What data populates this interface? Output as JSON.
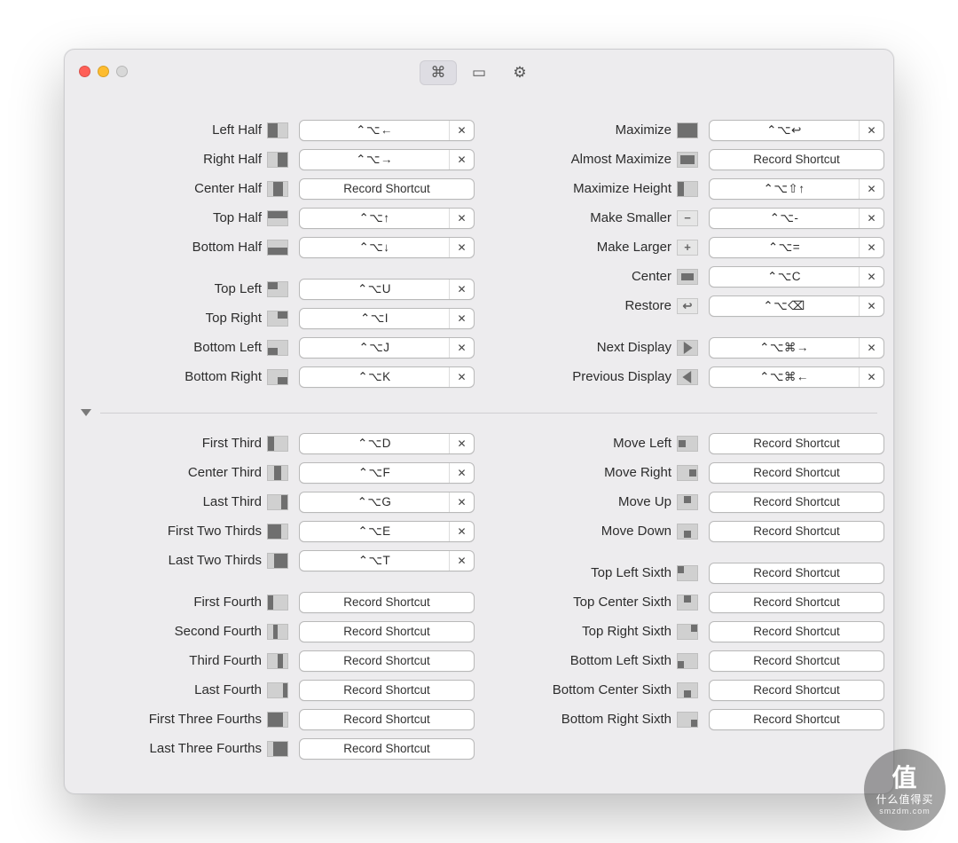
{
  "common": {
    "record_placeholder": "Record Shortcut",
    "clear_glyph": "✕"
  },
  "watermark": {
    "head": "值",
    "line1": "什么值得买",
    "line2": "smzdm.com"
  },
  "left": [
    {
      "group": [
        {
          "id": "left-half",
          "label": "Left Half",
          "shortcut": "⌃⌥←",
          "icon": "cols-1-2 p1"
        },
        {
          "id": "right-half",
          "label": "Right Half",
          "shortcut": "⌃⌥→",
          "icon": "cols-1-2 p2"
        },
        {
          "id": "center-half",
          "label": "Center Half",
          "shortcut": "",
          "icon": "center-h"
        },
        {
          "id": "top-half",
          "label": "Top Half",
          "shortcut": "⌃⌥↑",
          "icon": "rows-1-2 p1"
        },
        {
          "id": "bottom-half",
          "label": "Bottom Half",
          "shortcut": "⌃⌥↓",
          "icon": "rows-1-2 p2"
        }
      ]
    },
    {
      "group": [
        {
          "id": "top-left",
          "label": "Top Left",
          "shortcut": "⌃⌥U",
          "icon": "corners tl"
        },
        {
          "id": "top-right",
          "label": "Top Right",
          "shortcut": "⌃⌥I",
          "icon": "corners tr"
        },
        {
          "id": "bottom-left",
          "label": "Bottom Left",
          "shortcut": "⌃⌥J",
          "icon": "corners bl"
        },
        {
          "id": "bottom-right",
          "label": "Bottom Right",
          "shortcut": "⌃⌥K",
          "icon": "corners br"
        }
      ]
    }
  ],
  "right": [
    {
      "group": [
        {
          "id": "maximize",
          "label": "Maximize",
          "shortcut": "⌃⌥↩",
          "icon": "full"
        },
        {
          "id": "almost-maximize",
          "label": "Almost Maximize",
          "shortcut": "",
          "icon": "inset"
        },
        {
          "id": "maximize-height",
          "label": "Maximize Height",
          "shortcut": "⌃⌥⇧↑",
          "icon": "max-h"
        },
        {
          "id": "make-smaller",
          "label": "Make Smaller",
          "shortcut": "⌃⌥-",
          "icon": "glyph",
          "glyph": "−"
        },
        {
          "id": "make-larger",
          "label": "Make Larger",
          "shortcut": "⌃⌥=",
          "icon": "glyph",
          "glyph": "+"
        },
        {
          "id": "center",
          "label": "Center",
          "shortcut": "⌃⌥C",
          "icon": "center-win"
        },
        {
          "id": "restore",
          "label": "Restore",
          "shortcut": "⌃⌥⌫",
          "icon": "glyph",
          "glyph": "↩"
        }
      ]
    },
    {
      "group": [
        {
          "id": "next-display",
          "label": "Next Display",
          "shortcut": "⌃⌥⌘→",
          "icon": "arrow",
          "arrow": "r"
        },
        {
          "id": "previous-display",
          "label": "Previous Display",
          "shortcut": "⌃⌥⌘←",
          "icon": "arrow",
          "arrow": "l"
        }
      ]
    }
  ],
  "left2": [
    {
      "group": [
        {
          "id": "first-third",
          "label": "First Third",
          "shortcut": "⌃⌥D",
          "icon": "cols-1-3 p1"
        },
        {
          "id": "center-third",
          "label": "Center Third",
          "shortcut": "⌃⌥F",
          "icon": "cols-1-3 p2"
        },
        {
          "id": "last-third",
          "label": "Last Third",
          "shortcut": "⌃⌥G",
          "icon": "cols-1-3 p3"
        },
        {
          "id": "first-two-thirds",
          "label": "First Two Thirds",
          "shortcut": "⌃⌥E",
          "icon": "cols-2-3 p1"
        },
        {
          "id": "last-two-thirds",
          "label": "Last Two Thirds",
          "shortcut": "⌃⌥T",
          "icon": "cols-2-3 p2"
        }
      ]
    },
    {
      "group": [
        {
          "id": "first-fourth",
          "label": "First Fourth",
          "shortcut": "",
          "icon": "cols-1-4 p1"
        },
        {
          "id": "second-fourth",
          "label": "Second Fourth",
          "shortcut": "",
          "icon": "cols-1-4 p2"
        },
        {
          "id": "third-fourth",
          "label": "Third Fourth",
          "shortcut": "",
          "icon": "cols-1-4 p3"
        },
        {
          "id": "last-fourth",
          "label": "Last Fourth",
          "shortcut": "",
          "icon": "cols-1-4 p4"
        },
        {
          "id": "first-three-fourths",
          "label": "First Three Fourths",
          "shortcut": "",
          "icon": "cols-3-4 p1"
        },
        {
          "id": "last-three-fourths",
          "label": "Last Three Fourths",
          "shortcut": "",
          "icon": "cols-3-4 p2"
        }
      ]
    }
  ],
  "right2": [
    {
      "group": [
        {
          "id": "move-left",
          "label": "Move Left",
          "shortcut": "",
          "icon": "nudge l"
        },
        {
          "id": "move-right",
          "label": "Move Right",
          "shortcut": "",
          "icon": "nudge r"
        },
        {
          "id": "move-up",
          "label": "Move Up",
          "shortcut": "",
          "icon": "nudge u"
        },
        {
          "id": "move-down",
          "label": "Move Down",
          "shortcut": "",
          "icon": "nudge d"
        }
      ]
    },
    {
      "group": [
        {
          "id": "top-left-sixth",
          "label": "Top Left Sixth",
          "shortcut": "",
          "icon": "sixth tl"
        },
        {
          "id": "top-center-sixth",
          "label": "Top Center Sixth",
          "shortcut": "",
          "icon": "sixth tc"
        },
        {
          "id": "top-right-sixth",
          "label": "Top Right Sixth",
          "shortcut": "",
          "icon": "sixth tr"
        },
        {
          "id": "bottom-left-sixth",
          "label": "Bottom Left Sixth",
          "shortcut": "",
          "icon": "sixth bl"
        },
        {
          "id": "bottom-center-sixth",
          "label": "Bottom Center Sixth",
          "shortcut": "",
          "icon": "sixth bc"
        },
        {
          "id": "bottom-right-sixth",
          "label": "Bottom Right Sixth",
          "shortcut": "",
          "icon": "sixth br"
        }
      ]
    }
  ]
}
